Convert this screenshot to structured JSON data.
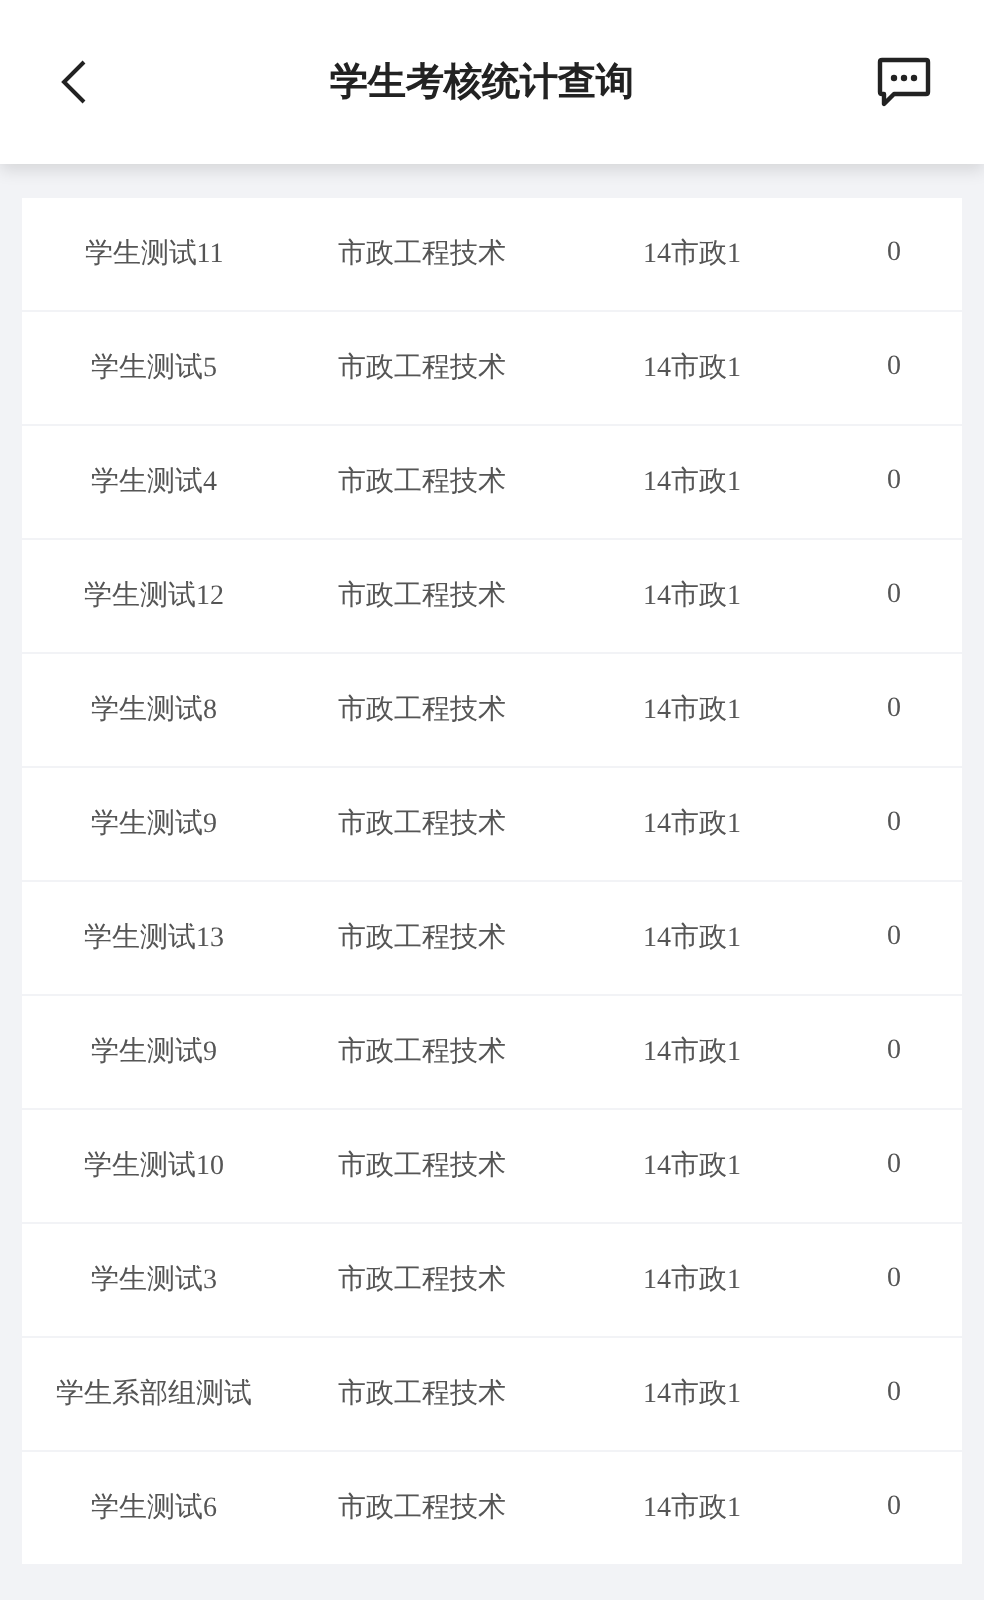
{
  "header": {
    "title": "学生考核统计查询"
  },
  "rows": [
    {
      "name": "学生测试11",
      "major": "市政工程技术",
      "class": "14市政1",
      "count": "0"
    },
    {
      "name": "学生测试5",
      "major": "市政工程技术",
      "class": "14市政1",
      "count": "0"
    },
    {
      "name": "学生测试4",
      "major": "市政工程技术",
      "class": "14市政1",
      "count": "0"
    },
    {
      "name": "学生测试12",
      "major": "市政工程技术",
      "class": "14市政1",
      "count": "0"
    },
    {
      "name": "学生测试8",
      "major": "市政工程技术",
      "class": "14市政1",
      "count": "0"
    },
    {
      "name": "学生测试9",
      "major": "市政工程技术",
      "class": "14市政1",
      "count": "0"
    },
    {
      "name": "学生测试13",
      "major": "市政工程技术",
      "class": "14市政1",
      "count": "0"
    },
    {
      "name": "学生测试9",
      "major": "市政工程技术",
      "class": "14市政1",
      "count": "0"
    },
    {
      "name": "学生测试10",
      "major": "市政工程技术",
      "class": "14市政1",
      "count": "0"
    },
    {
      "name": "学生测试3",
      "major": "市政工程技术",
      "class": "14市政1",
      "count": "0"
    },
    {
      "name": "学生系部组测试",
      "major": "市政工程技术",
      "class": "14市政1",
      "count": "0"
    },
    {
      "name": "学生测试6",
      "major": "市政工程技术",
      "class": "14市政1",
      "count": "0"
    }
  ]
}
